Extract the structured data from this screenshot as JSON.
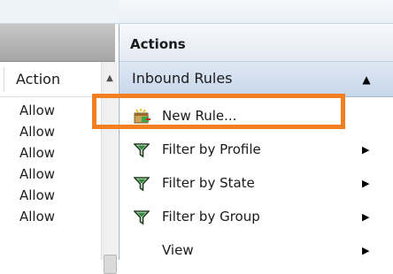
{
  "left_pane": {
    "column_header": "Action",
    "rows": [
      "Allow",
      "Allow",
      "Allow",
      "Allow",
      "Allow",
      "Allow"
    ]
  },
  "actions_pane": {
    "title": "Actions",
    "section": {
      "label": "Inbound Rules",
      "collapse_icon": "triangle-up"
    },
    "items": [
      {
        "label": "New Rule...",
        "icon": "new-rule-icon",
        "has_submenu": false
      },
      {
        "label": "Filter by Profile",
        "icon": "filter-funnel-icon",
        "has_submenu": true
      },
      {
        "label": "Filter by State",
        "icon": "filter-funnel-icon",
        "has_submenu": true
      },
      {
        "label": "Filter by Group",
        "icon": "filter-funnel-icon",
        "has_submenu": true
      },
      {
        "label": "View",
        "icon": "",
        "has_submenu": true
      }
    ]
  },
  "annotation": {
    "color": "#f47f20",
    "target": "New Rule..."
  }
}
